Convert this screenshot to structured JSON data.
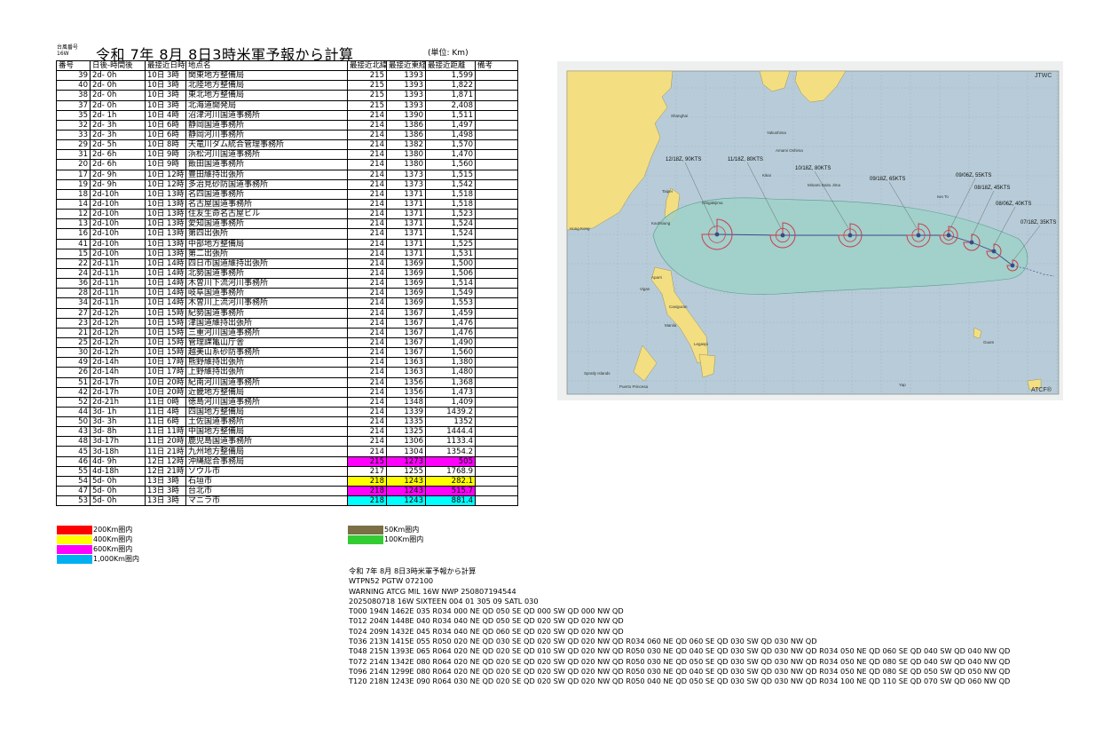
{
  "header": {
    "typhoon_no_label": "台風番号",
    "typhoon_id": "16W",
    "title": "令和 7年 8月 8日3時米軍予報から計算",
    "unit": "(単位: Km)"
  },
  "table": {
    "columns": [
      "番号",
      "日後-時間後",
      "最接近日時",
      "地点名",
      "最接近北緯",
      "最接近東経",
      "最接近距離",
      "備考"
    ],
    "rows": [
      {
        "no": "39",
        "after": "2d- 0h",
        "when": "10日 3時",
        "name": "関東地方整備局",
        "lat": "215",
        "lon": "1393",
        "dist": "1,599",
        "hl": ""
      },
      {
        "no": "40",
        "after": "2d- 0h",
        "when": "10日 3時",
        "name": "北陸地方整備局",
        "lat": "215",
        "lon": "1393",
        "dist": "1,822",
        "hl": ""
      },
      {
        "no": "38",
        "after": "2d- 0h",
        "when": "10日 3時",
        "name": "東北地方整備局",
        "lat": "215",
        "lon": "1393",
        "dist": "1,871",
        "hl": ""
      },
      {
        "no": "37",
        "after": "2d- 0h",
        "when": "10日 3時",
        "name": "北海道開発局",
        "lat": "215",
        "lon": "1393",
        "dist": "2,408",
        "hl": ""
      },
      {
        "no": "35",
        "after": "2d- 1h",
        "when": "10日 4時",
        "name": "沼津河川国道事務所",
        "lat": "214",
        "lon": "1390",
        "dist": "1,511",
        "hl": ""
      },
      {
        "no": "32",
        "after": "2d- 3h",
        "when": "10日 6時",
        "name": "静岡国道事務所",
        "lat": "214",
        "lon": "1386",
        "dist": "1,497",
        "hl": ""
      },
      {
        "no": "33",
        "after": "2d- 3h",
        "when": "10日 6時",
        "name": "静岡河川事務所",
        "lat": "214",
        "lon": "1386",
        "dist": "1,498",
        "hl": ""
      },
      {
        "no": "29",
        "after": "2d- 5h",
        "when": "10日 8時",
        "name": "天竜川ダム統合管理事務所",
        "lat": "214",
        "lon": "1382",
        "dist": "1,570",
        "hl": ""
      },
      {
        "no": "31",
        "after": "2d- 6h",
        "when": "10日 9時",
        "name": "浜松河川国道事務所",
        "lat": "214",
        "lon": "1380",
        "dist": "1,470",
        "hl": ""
      },
      {
        "no": "20",
        "after": "2d- 6h",
        "when": "10日 9時",
        "name": "飯田国道事務所",
        "lat": "214",
        "lon": "1380",
        "dist": "1,560",
        "hl": ""
      },
      {
        "no": "17",
        "after": "2d- 9h",
        "when": "10日 12時",
        "name": "豊田維持出張所",
        "lat": "214",
        "lon": "1373",
        "dist": "1,515",
        "hl": ""
      },
      {
        "no": "19",
        "after": "2d- 9h",
        "when": "10日 12時",
        "name": "多治見砂防国道事務所",
        "lat": "214",
        "lon": "1373",
        "dist": "1,542",
        "hl": ""
      },
      {
        "no": "18",
        "after": "2d-10h",
        "when": "10日 13時",
        "name": "名四国道事務所",
        "lat": "214",
        "lon": "1371",
        "dist": "1,518",
        "hl": ""
      },
      {
        "no": "14",
        "after": "2d-10h",
        "when": "10日 13時",
        "name": "名古屋国道事務所",
        "lat": "214",
        "lon": "1371",
        "dist": "1,518",
        "hl": ""
      },
      {
        "no": "12",
        "after": "2d-10h",
        "when": "10日 13時",
        "name": "住友生命名古屋ビル",
        "lat": "214",
        "lon": "1371",
        "dist": "1,523",
        "hl": ""
      },
      {
        "no": "13",
        "after": "2d-10h",
        "when": "10日 13時",
        "name": "愛知国道事務所",
        "lat": "214",
        "lon": "1371",
        "dist": "1,524",
        "hl": ""
      },
      {
        "no": "16",
        "after": "2d-10h",
        "when": "10日 13時",
        "name": "第四出張所",
        "lat": "214",
        "lon": "1371",
        "dist": "1,524",
        "hl": ""
      },
      {
        "no": "41",
        "after": "2d-10h",
        "when": "10日 13時",
        "name": "中部地方整備局",
        "lat": "214",
        "lon": "1371",
        "dist": "1,525",
        "hl": ""
      },
      {
        "no": "15",
        "after": "2d-10h",
        "when": "10日 13時",
        "name": "第二出張所",
        "lat": "214",
        "lon": "1371",
        "dist": "1,531",
        "hl": ""
      },
      {
        "no": "22",
        "after": "2d-11h",
        "when": "10日 14時",
        "name": "四日市国道維持出張所",
        "lat": "214",
        "lon": "1369",
        "dist": "1,500",
        "hl": ""
      },
      {
        "no": "24",
        "after": "2d-11h",
        "when": "10日 14時",
        "name": "北勢国道事務所",
        "lat": "214",
        "lon": "1369",
        "dist": "1,506",
        "hl": ""
      },
      {
        "no": "36",
        "after": "2d-11h",
        "when": "10日 14時",
        "name": "木曽川下流河川事務所",
        "lat": "214",
        "lon": "1369",
        "dist": "1,514",
        "hl": ""
      },
      {
        "no": "28",
        "after": "2d-11h",
        "when": "10日 14時",
        "name": "岐阜国道事務所",
        "lat": "214",
        "lon": "1369",
        "dist": "1,549",
        "hl": ""
      },
      {
        "no": "34",
        "after": "2d-11h",
        "when": "10日 14時",
        "name": "木曽川上流河川事務所",
        "lat": "214",
        "lon": "1369",
        "dist": "1,553",
        "hl": ""
      },
      {
        "no": "27",
        "after": "2d-12h",
        "when": "10日 15時",
        "name": "紀勢国道事務所",
        "lat": "214",
        "lon": "1367",
        "dist": "1,459",
        "hl": ""
      },
      {
        "no": "23",
        "after": "2d-12h",
        "when": "10日 15時",
        "name": "津国道維持出張所",
        "lat": "214",
        "lon": "1367",
        "dist": "1,476",
        "hl": ""
      },
      {
        "no": "21",
        "after": "2d-12h",
        "when": "10日 15時",
        "name": "三重河川国道事務所",
        "lat": "214",
        "lon": "1367",
        "dist": "1,476",
        "hl": ""
      },
      {
        "no": "25",
        "after": "2d-12h",
        "when": "10日 15時",
        "name": "管理課亀山庁舎",
        "lat": "214",
        "lon": "1367",
        "dist": "1,490",
        "hl": ""
      },
      {
        "no": "30",
        "after": "2d-12h",
        "when": "10日 15時",
        "name": "越美山系砂防事務所",
        "lat": "214",
        "lon": "1367",
        "dist": "1,560",
        "hl": ""
      },
      {
        "no": "49",
        "after": "2d-14h",
        "when": "10日 17時",
        "name": "熊野維持出張所",
        "lat": "214",
        "lon": "1363",
        "dist": "1,380",
        "hl": ""
      },
      {
        "no": "26",
        "after": "2d-14h",
        "when": "10日 17時",
        "name": "上野維持出張所",
        "lat": "214",
        "lon": "1363",
        "dist": "1,480",
        "hl": ""
      },
      {
        "no": "51",
        "after": "2d-17h",
        "when": "10日 20時",
        "name": "紀南河川国道事務所",
        "lat": "214",
        "lon": "1356",
        "dist": "1,368",
        "hl": ""
      },
      {
        "no": "42",
        "after": "2d-17h",
        "when": "10日 20時",
        "name": "近畿地方整備局",
        "lat": "214",
        "lon": "1356",
        "dist": "1,473",
        "hl": ""
      },
      {
        "no": "52",
        "after": "2d-21h",
        "when": "11日 0時",
        "name": "徳島河川国道事務所",
        "lat": "214",
        "lon": "1348",
        "dist": "1,409",
        "hl": ""
      },
      {
        "no": "44",
        "after": "3d- 1h",
        "when": "11日 4時",
        "name": "四国地方整備局",
        "lat": "214",
        "lon": "1339",
        "dist": "1439.2",
        "hl": ""
      },
      {
        "no": "50",
        "after": "3d- 3h",
        "when": "11日 6時",
        "name": "土佐国道事務所",
        "lat": "214",
        "lon": "1335",
        "dist": "1352",
        "hl": ""
      },
      {
        "no": "43",
        "after": "3d- 8h",
        "when": "11日 11時",
        "name": "中国地方整備局",
        "lat": "214",
        "lon": "1325",
        "dist": "1444.4",
        "hl": ""
      },
      {
        "no": "48",
        "after": "3d-17h",
        "when": "11日 20時",
        "name": "鹿児島国道事務所",
        "lat": "214",
        "lon": "1306",
        "dist": "1133.4",
        "hl": ""
      },
      {
        "no": "45",
        "after": "3d-18h",
        "when": "11日 21時",
        "name": "九州地方整備局",
        "lat": "214",
        "lon": "1304",
        "dist": "1354.2",
        "hl": ""
      },
      {
        "no": "46",
        "after": "4d- 9h",
        "when": "12日 12時",
        "name": "沖縄総合事務局",
        "lat": "215",
        "lon": "1273",
        "dist": "505",
        "hl": "magenta"
      },
      {
        "no": "55",
        "after": "4d-18h",
        "when": "12日 21時",
        "name": "ソウル市",
        "lat": "217",
        "lon": "1255",
        "dist": "1768.9",
        "hl": ""
      },
      {
        "no": "54",
        "after": "5d- 0h",
        "when": "13日 3時",
        "name": "石垣市",
        "lat": "218",
        "lon": "1243",
        "dist": "282.1",
        "hl": "yellow"
      },
      {
        "no": "47",
        "after": "5d- 0h",
        "when": "13日 3時",
        "name": "台北市",
        "lat": "218",
        "lon": "1243",
        "dist": "515.7",
        "hl": "magenta"
      },
      {
        "no": "53",
        "after": "5d- 0h",
        "when": "13日 3時",
        "name": "マニラ市",
        "lat": "218",
        "lon": "1243",
        "dist": "881.4",
        "hl": "cyan"
      }
    ]
  },
  "legend": [
    {
      "label": "200Km圏内",
      "color": "#ff0000"
    },
    {
      "label": "400Km圏内",
      "color": "#ffff00"
    },
    {
      "label": "600Km圏内",
      "color": "#ff00ff"
    },
    {
      "label": "1,000Km圏内",
      "color": "#00b0f0"
    },
    {
      "label": "50Km圏内",
      "color": "#7a6f45"
    },
    {
      "label": "100Km圏内",
      "color": "#33cc33"
    }
  ],
  "map": {
    "agency_label": "JTWC",
    "footer_label": "ATCF®",
    "forecasts": [
      {
        "label": "12/18Z, 90KTS"
      },
      {
        "label": "11/18Z, 80KTS"
      },
      {
        "label": "10/18Z, 80KTS"
      },
      {
        "label": "09/18Z, 65KTS"
      },
      {
        "label": "09/06Z, 55KTS"
      },
      {
        "label": "08/18Z, 45KTS"
      },
      {
        "label": "08/06Z, 40KTS"
      },
      {
        "label": "07/18Z, 35KTS"
      }
    ],
    "places": [
      "Shanghai",
      "Yakushima",
      "Amami Oshima",
      "Kikai",
      "Minami Daito Jima",
      "Iwo To",
      "Taipei",
      "Ishigakijima",
      "Kaohsiung",
      "Hong Kong",
      "Aparri",
      "Vigan",
      "Casiguran",
      "Manila",
      "Legaspi",
      "Spratly Islands",
      "Puerto Princesa",
      "Guam",
      "Yap"
    ],
    "colors": {
      "sea": "#b7ccd8",
      "land": "#f3df82",
      "cone": "#9fd0c8",
      "track": "#3a4a8a",
      "wind34": "#c83c50"
    }
  },
  "message": {
    "lines": [
      "令和 7年 8月 8日3時米軍予報から計算",
      "WTPN52 PGTW 072100",
      "WARNING     ATCG MIL 16W NWP 250807194544",
      "2025080718 16W SIXTEEN     004  01 305 09 SATL 030",
      "T000 194N 1462E 035 R034 000 NE QD 050 SE QD 000 SW QD 000 NW QD",
      "T012 204N 1448E 040 R034 040 NE QD 050 SE QD 020 SW QD 020 NW QD",
      "T024 209N 1432E 045 R034 040 NE QD 060 SE QD 020 SW QD 020 NW QD",
      "T036 213N 1415E 055 R050 020 NE QD 030 SE QD 020 SW QD 020 NW QD R034 060 NE QD 060 SE QD 030 SW QD 030 NW QD",
      "T048 215N 1393E 065 R064 020 NE QD 020 SE QD 010 SW QD 020 NW QD R050 030 NE QD 040 SE QD 030 SW QD 030 NW QD R034 050 NE QD 060 SE QD 040 SW QD 040 NW QD",
      "T072 214N 1342E 080 R064 020 NE QD 020 SE QD 020 SW QD 020 NW QD R050 030 NE QD 050 SE QD 030 SW QD 030 NW QD R034 050 NE QD 080 SE QD 040 SW QD 040 NW QD",
      "T096 214N 1299E 080 R064 020 NE QD 020 SE QD 020 SW QD 020 NW QD R050 030 NE QD 040 SE QD 030 SW QD 030 NW QD R034 050 NE QD 080 SE QD 050 SW QD 050 NW QD",
      "T120 218N 1243E 090 R064 030 NE QD 020 SE QD 020 SW QD 020 NW QD R050 040 NE QD 050 SE QD 030 SW QD 030 NW QD R034 100 NE QD 110 SE QD 070 SW QD 060 NW QD"
    ]
  }
}
